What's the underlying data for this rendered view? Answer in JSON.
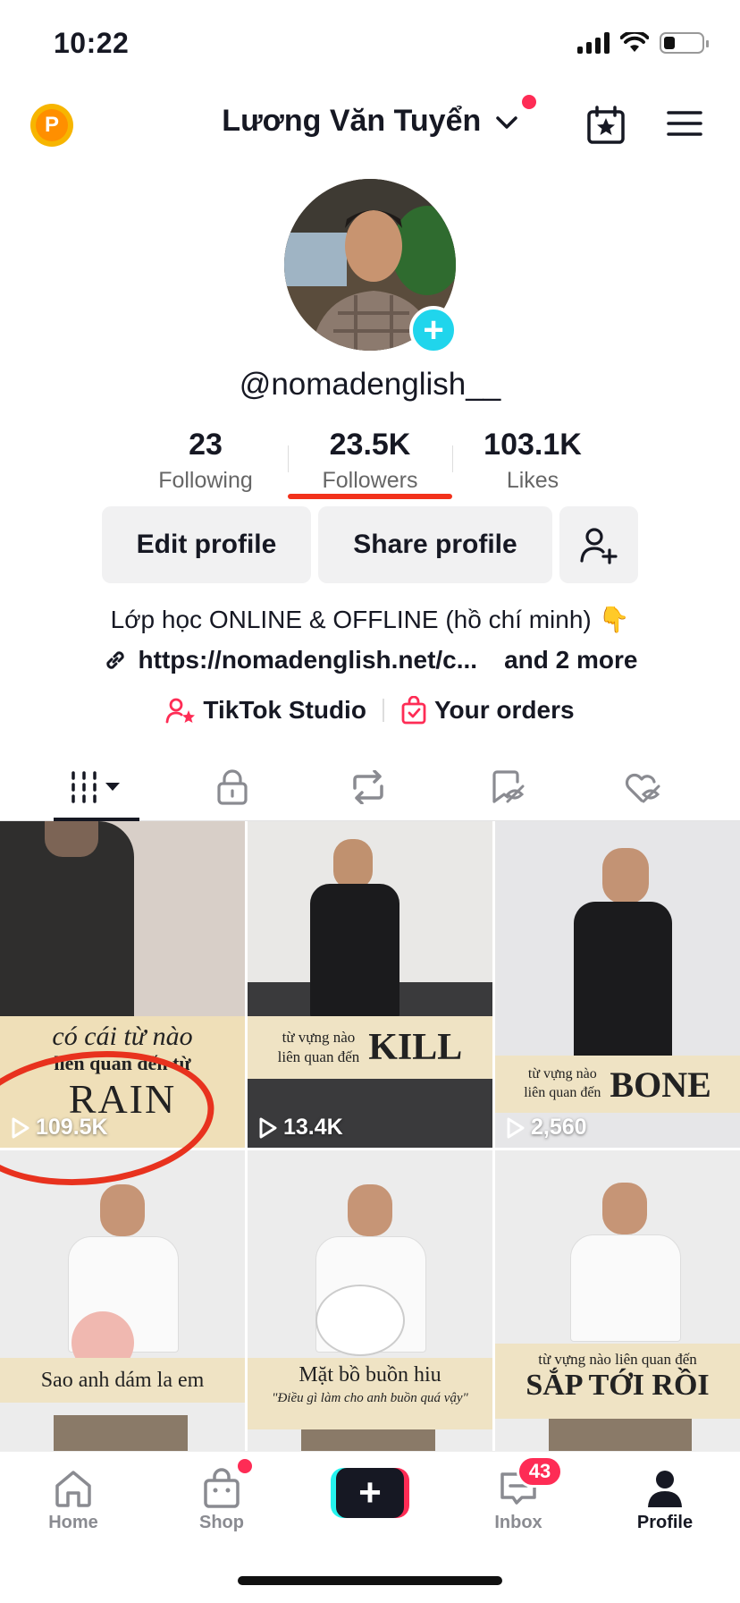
{
  "status_bar": {
    "time": "10:22",
    "battery_level": 0.25
  },
  "header": {
    "account_name": "Lương Văn Tuyển"
  },
  "profile": {
    "username": "@nomadenglish__",
    "stats": [
      {
        "value": "23",
        "label": "Following"
      },
      {
        "value": "23.5K",
        "label": "Followers"
      },
      {
        "value": "103.1K",
        "label": "Likes"
      }
    ],
    "buttons": {
      "edit": "Edit profile",
      "share": "Share profile"
    },
    "bio": "Lớp học ONLINE & OFFLINE (hồ chí minh) 👇",
    "link": "https://nomadenglish.net/c...",
    "link_more": "and 2 more",
    "tools": {
      "studio": "TikTok Studio",
      "orders": "Your orders"
    }
  },
  "colors": {
    "accent": "#fe2c55",
    "cyan": "#25f4ee",
    "annotation_red": "#e8321e"
  },
  "videos": [
    {
      "views": "109.5K",
      "caption_lines": [
        "có cái từ nào",
        "liên quan đến từ",
        "RAIN"
      ]
    },
    {
      "views": "13.4K",
      "caption_lines": [
        "từ vựng nào",
        "liên quan đến",
        "KILL"
      ]
    },
    {
      "views": "2,560",
      "caption_lines": [
        "từ vựng nào",
        "liên quan đến",
        "BONE"
      ]
    },
    {
      "views": "",
      "caption_lines": [
        "Sao anh dám la em"
      ]
    },
    {
      "views": "",
      "caption_lines": [
        "Mặt bồ buồn hiu",
        "\"Điều gì làm cho anh buồn quá vậy\""
      ]
    },
    {
      "views": "",
      "caption_lines": [
        "từ vựng nào liên quan đến",
        "SẮP TỚI RỒI"
      ]
    }
  ],
  "bottom_nav": {
    "home": "Home",
    "shop": "Shop",
    "inbox": "Inbox",
    "inbox_badge": "43",
    "profile": "Profile"
  }
}
